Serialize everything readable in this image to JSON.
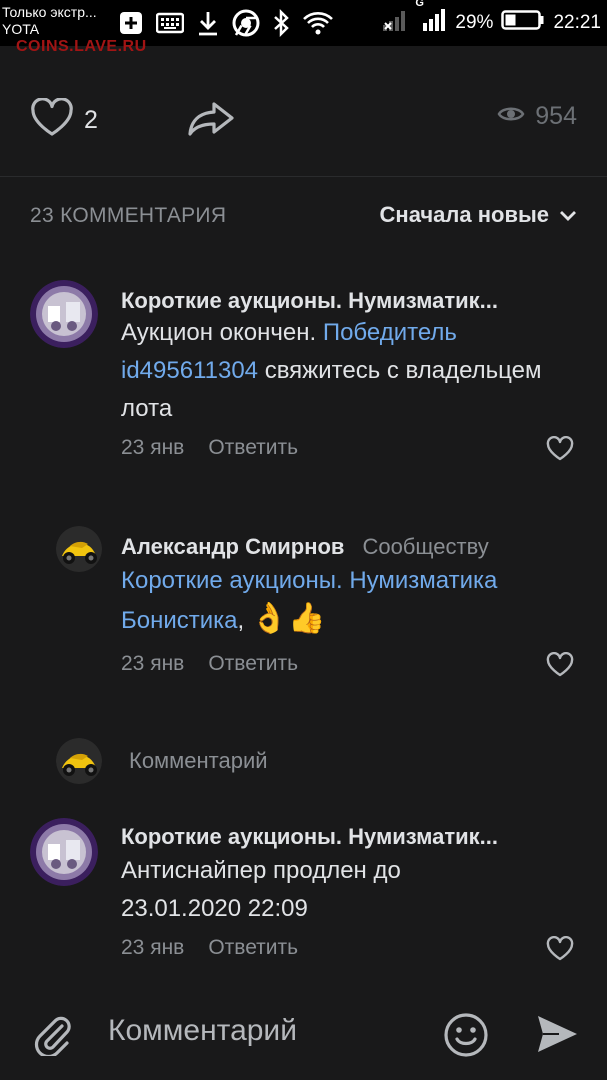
{
  "status_bar": {
    "notification_text": "Только экстр...",
    "carrier": "YOTA",
    "network": "G",
    "battery": "29%",
    "time": "22:21"
  },
  "watermark": "COINS.LAVE.RU",
  "post_actions": {
    "likes": "2",
    "views": "954"
  },
  "comments_section": {
    "count_label": "23 КОММЕНТАРИЯ",
    "sort_label": "Сначала новые"
  },
  "comments": [
    {
      "author": "Короткие аукционы. Нумизматик...",
      "text_before": "Аукцион окончен. ",
      "link": "Победитель id495611304",
      "text_after": " свяжитесь с владельцем лота",
      "date": "23 янв",
      "reply_label": "Ответить"
    },
    {
      "author": "Александр Смирнов",
      "reply_to": "Сообществу",
      "link": "Короткие аукционы. Нумизматика Бонистика",
      "text_after": ",",
      "emoji": "👌👍",
      "date": "23 янв",
      "reply_label": "Ответить"
    },
    {
      "author": "Короткие аукционы. Нумизматик...",
      "text": "Антиснайпер продлен до 23.01.2020 22:09",
      "date": "23 янв",
      "reply_label": "Ответить"
    }
  ],
  "reply_input": {
    "placeholder": "Комментарий"
  },
  "composer": {
    "placeholder": "Комментарий"
  },
  "colors": {
    "background": "#19191a",
    "link": "#71aaeb",
    "secondary_text": "#8b8f94",
    "primary_text": "#e1e3e6"
  }
}
